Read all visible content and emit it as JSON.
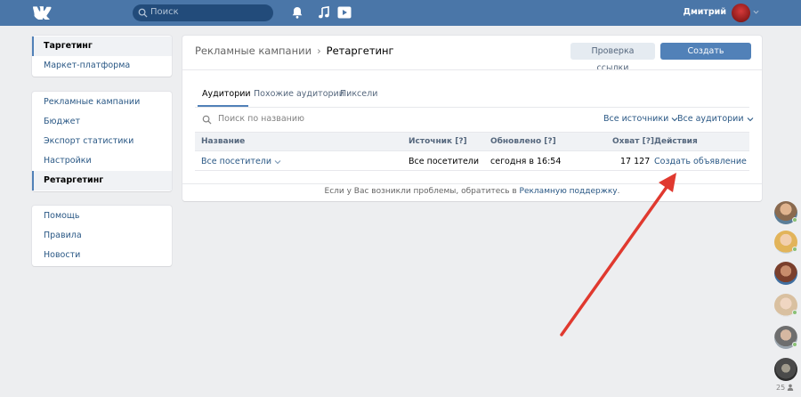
{
  "header": {
    "search_placeholder": "Поиск",
    "user_name": "Дмитрий"
  },
  "sidebar": {
    "group1": [
      {
        "label": "Таргетинг",
        "active": true
      },
      {
        "label": "Маркет-платформа",
        "active": false
      }
    ],
    "group2": [
      {
        "label": "Рекламные кампании",
        "active": false
      },
      {
        "label": "Бюджет",
        "active": false
      },
      {
        "label": "Экспорт статистики",
        "active": false
      },
      {
        "label": "Настройки",
        "active": false
      },
      {
        "label": "Ретаргетинг",
        "active": true
      }
    ],
    "group3": [
      {
        "label": "Помощь",
        "active": false
      },
      {
        "label": "Правила",
        "active": false
      },
      {
        "label": "Новости",
        "active": false
      }
    ]
  },
  "main": {
    "breadcrumb": {
      "parent": "Рекламные кампании",
      "separator": "›",
      "current": "Ретаргетинг"
    },
    "buttons": {
      "check_link": "Проверка ссылки",
      "create_audience": "Создать аудиторию"
    },
    "tabs": [
      {
        "label": "Аудитории",
        "active": true
      },
      {
        "label": "Похожие аудитории",
        "active": false
      },
      {
        "label": "Пиксели",
        "active": false
      }
    ],
    "filter": {
      "search_placeholder": "Поиск по названию",
      "sources_dropdown": "Все источники",
      "audiences_dropdown": "Все аудитории"
    },
    "table": {
      "columns": [
        "Название",
        "Источник [?]",
        "Обновлено [?]",
        "Охват [?]",
        "Действия"
      ],
      "rows": [
        {
          "name": "Все посетители",
          "source": "Все посетители",
          "updated": "сегодня в 16:54",
          "reach": "17 127",
          "action": "Создать объявление"
        }
      ]
    },
    "footer": {
      "text": "Если у Вас возникли проблемы, обратитесь в ",
      "link": "Рекламную поддержку",
      "end": "."
    }
  },
  "friends_rail": {
    "count": "25"
  },
  "colors": {
    "header_bg": "#4a76a8",
    "accent": "#5181b8",
    "link": "#2a5885",
    "annotation_arrow": "#e0392f"
  }
}
